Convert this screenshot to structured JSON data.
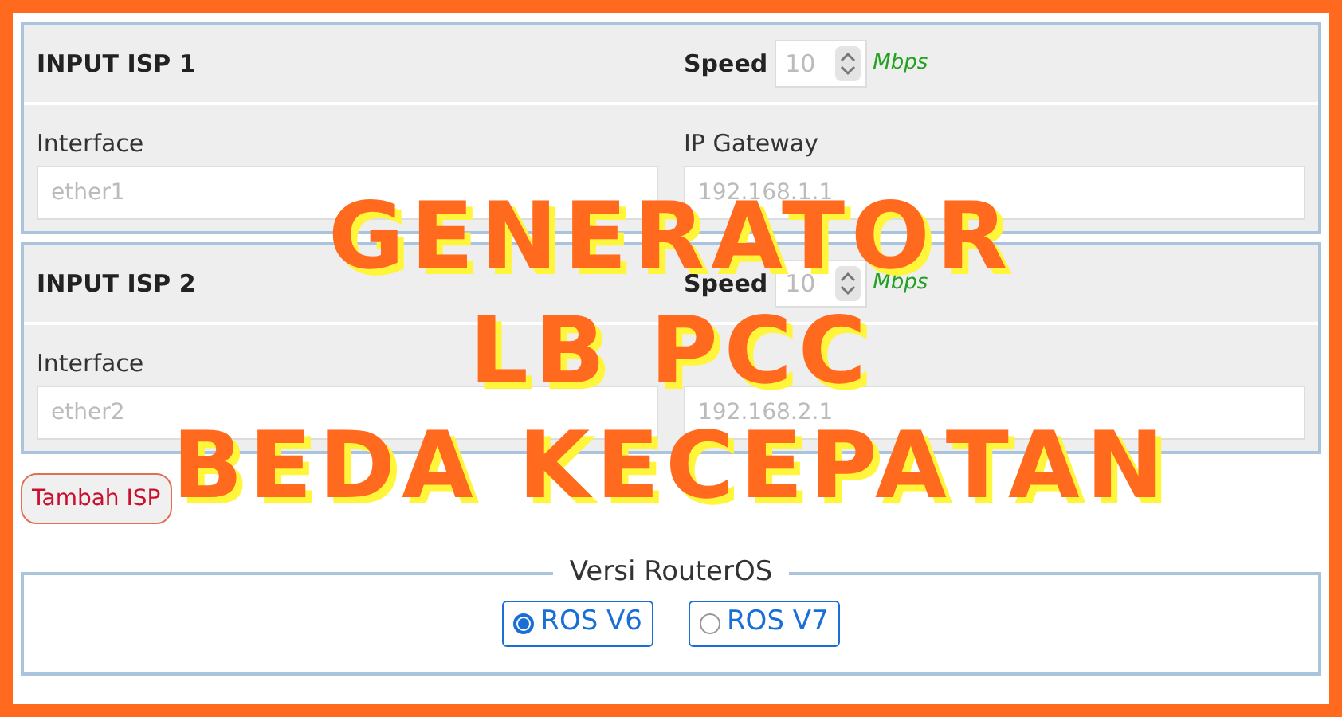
{
  "isps": [
    {
      "title": "INPUT ISP 1",
      "speed_label": "Speed",
      "speed_placeholder": "10",
      "speed_unit": "Mbps",
      "interface_label": "Interface",
      "interface_placeholder": "ether1",
      "gateway_label": "IP Gateway",
      "gateway_placeholder": "192.168.1.1"
    },
    {
      "title": "INPUT ISP 2",
      "speed_label": "Speed",
      "speed_placeholder": "10",
      "speed_unit": "Mbps",
      "interface_label": "Interface",
      "interface_placeholder": "ether2",
      "gateway_placeholder": "192.168.2.1"
    }
  ],
  "add_button": "Tambah ISP",
  "version": {
    "legend": "Versi RouterOS",
    "options": [
      {
        "label": "ROS V6",
        "selected": true
      },
      {
        "label": "ROS V7",
        "selected": false
      }
    ]
  },
  "overlay_title": [
    "GENERATOR",
    "LB PCC",
    "BEDA KECEPATAN"
  ]
}
